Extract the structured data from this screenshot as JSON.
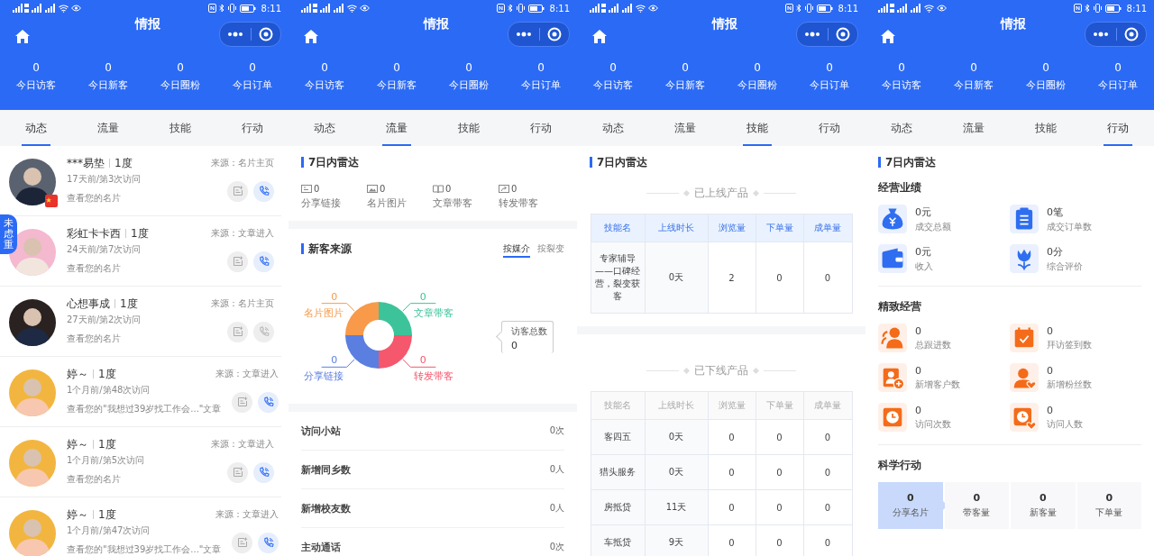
{
  "screens": [
    {
      "status_bar": {
        "time": "8:11"
      },
      "title": "情报",
      "stats": [
        {
          "value": "0",
          "label": "今日访客"
        },
        {
          "value": "0",
          "label": "今日新客"
        },
        {
          "value": "0",
          "label": "今日圈粉"
        },
        {
          "value": "0",
          "label": "今日订单"
        }
      ],
      "tabs": [
        {
          "label": "动态",
          "selected": true
        },
        {
          "label": "流量",
          "selected": false
        },
        {
          "label": "技能",
          "selected": false
        },
        {
          "label": "行动",
          "selected": false
        }
      ],
      "content": {
        "kind": "feed",
        "side_tab": "未虑重",
        "items": [
          {
            "name": "***易垫",
            "degree": "1度",
            "visit": "17天前/第3次访问",
            "action": "查看您的名片",
            "source": "来源：名片主页",
            "call_enabled": true,
            "flag_badge": true
          },
          {
            "name": "彩虹卡卡西",
            "degree": "1度",
            "visit": "24天前/第7次访问",
            "action": "查看您的名片",
            "source": "来源：文章进入",
            "call_enabled": true,
            "flag_badge": false
          },
          {
            "name": "心想事成",
            "degree": "1度",
            "visit": "27天前/第2次访问",
            "action": "查看您的名片",
            "source": "来源：名片主页",
            "call_enabled": false,
            "flag_badge": false
          },
          {
            "name": "婷～",
            "degree": "1度",
            "visit": "1个月前/第48次访问",
            "action": "查看您的\"我想过39岁找工作会...\"文章",
            "source": "来源：文章进入",
            "call_enabled": true,
            "flag_badge": false
          },
          {
            "name": "婷～",
            "degree": "1度",
            "visit": "1个月前/第5次访问",
            "action": "查看您的名片",
            "source": "来源：文章进入",
            "call_enabled": true,
            "flag_badge": false
          },
          {
            "name": "婷～",
            "degree": "1度",
            "visit": "1个月前/第47次访问",
            "action": "查看您的\"我想过39岁找工作会...\"文章",
            "source": "来源：文章进入",
            "call_enabled": true,
            "flag_badge": false
          }
        ]
      }
    },
    {
      "status_bar": {
        "time": "8:11"
      },
      "title": "情报",
      "stats": [
        {
          "value": "0",
          "label": "今日访客"
        },
        {
          "value": "0",
          "label": "今日新客"
        },
        {
          "value": "0",
          "label": "今日圈粉"
        },
        {
          "value": "0",
          "label": "今日订单"
        }
      ],
      "tabs": [
        {
          "label": "动态",
          "selected": false
        },
        {
          "label": "流量",
          "selected": true
        },
        {
          "label": "技能",
          "selected": false
        },
        {
          "label": "行动",
          "selected": false
        }
      ],
      "content": {
        "kind": "traffic",
        "radar": {
          "title": "7日内雷达",
          "items": [
            {
              "value": "0",
              "label": "分享链接"
            },
            {
              "value": "0",
              "label": "名片图片"
            },
            {
              "value": "0",
              "label": "文章带客"
            },
            {
              "value": "0",
              "label": "转发带客"
            }
          ]
        },
        "sources": {
          "title": "新客来源",
          "tabs": [
            {
              "label": "按媒介",
              "selected": true
            },
            {
              "label": "按裂变",
              "selected": false
            }
          ],
          "segments": [
            {
              "label": "名片图片",
              "value": "0",
              "color": "#f89a4a"
            },
            {
              "label": "文章带客",
              "value": "0",
              "color": "#3cc39a"
            },
            {
              "label": "分享链接",
              "value": "0",
              "color": "#5b7fe0"
            },
            {
              "label": "转发带客",
              "value": "0",
              "color": "#f5576c"
            }
          ],
          "tooltip": {
            "label": "访客总数",
            "value": "0"
          }
        },
        "list": [
          {
            "label": "访问小站",
            "value": "0次"
          },
          {
            "label": "新增同乡数",
            "value": "0人"
          },
          {
            "label": "新增校友数",
            "value": "0人"
          },
          {
            "label": "主动通话",
            "value": "0次"
          }
        ]
      }
    },
    {
      "status_bar": {
        "time": "8:11"
      },
      "title": "情报",
      "stats": [
        {
          "value": "0",
          "label": "今日访客"
        },
        {
          "value": "0",
          "label": "今日新客"
        },
        {
          "value": "0",
          "label": "今日圈粉"
        },
        {
          "value": "0",
          "label": "今日订单"
        }
      ],
      "tabs": [
        {
          "label": "动态",
          "selected": false
        },
        {
          "label": "流量",
          "selected": false
        },
        {
          "label": "技能",
          "selected": true
        },
        {
          "label": "行动",
          "selected": false
        }
      ],
      "content": {
        "kind": "skills",
        "title": "7日内雷达",
        "tables": [
          {
            "heading": "已上线产品",
            "online": true,
            "columns": [
              "技能名",
              "上线时长",
              "浏览量",
              "下单量",
              "成单量"
            ],
            "rows": [
              [
                "专家辅导——口碑经营，裂变获客",
                "0天",
                "2",
                "0",
                "0"
              ]
            ]
          },
          {
            "heading": "已下线产品",
            "online": false,
            "columns": [
              "技能名",
              "上线时长",
              "浏览量",
              "下单量",
              "成单量"
            ],
            "rows": [
              [
                "客四五",
                "0天",
                "0",
                "0",
                "0"
              ],
              [
                "猎头服务",
                "0天",
                "0",
                "0",
                "0"
              ],
              [
                "房抵贷",
                "11天",
                "0",
                "0",
                "0"
              ],
              [
                "车抵贷",
                "9天",
                "0",
                "0",
                "0"
              ]
            ]
          }
        ]
      }
    },
    {
      "status_bar": {
        "time": "8:11"
      },
      "title": "情报",
      "stats": [
        {
          "value": "0",
          "label": "今日访客"
        },
        {
          "value": "0",
          "label": "今日新客"
        },
        {
          "value": "0",
          "label": "今日圈粉"
        },
        {
          "value": "0",
          "label": "今日订单"
        }
      ],
      "tabs": [
        {
          "label": "动态",
          "selected": false
        },
        {
          "label": "流量",
          "selected": false
        },
        {
          "label": "技能",
          "selected": false
        },
        {
          "label": "行动",
          "selected": true
        }
      ],
      "content": {
        "kind": "actions",
        "title": "7日内雷达",
        "groups": [
          {
            "title": "经营业绩",
            "color": "#2f6ef0",
            "metrics": [
              {
                "value": "0元",
                "label": "成交总额"
              },
              {
                "value": "0笔",
                "label": "成交订单数"
              },
              {
                "value": "0元",
                "label": "收入"
              },
              {
                "value": "0分",
                "label": "综合评价"
              }
            ]
          },
          {
            "title": "精致经营",
            "color": "#f46b1a",
            "metrics": [
              {
                "value": "0",
                "label": "总跟进数"
              },
              {
                "value": "0",
                "label": "拜访签到数"
              },
              {
                "value": "0",
                "label": "新增客户数"
              },
              {
                "value": "0",
                "label": "新增粉丝数"
              },
              {
                "value": "0",
                "label": "访问次数"
              },
              {
                "value": "0",
                "label": "访问人数"
              }
            ]
          }
        ],
        "science": {
          "title": "科学行动",
          "tabs": [
            {
              "value": "0",
              "label": "分享名片",
              "selected": true
            },
            {
              "value": "0",
              "label": "带客量",
              "selected": false
            },
            {
              "value": "0",
              "label": "新客量",
              "selected": false
            },
            {
              "value": "0",
              "label": "下单量",
              "selected": false
            }
          ]
        }
      }
    }
  ]
}
